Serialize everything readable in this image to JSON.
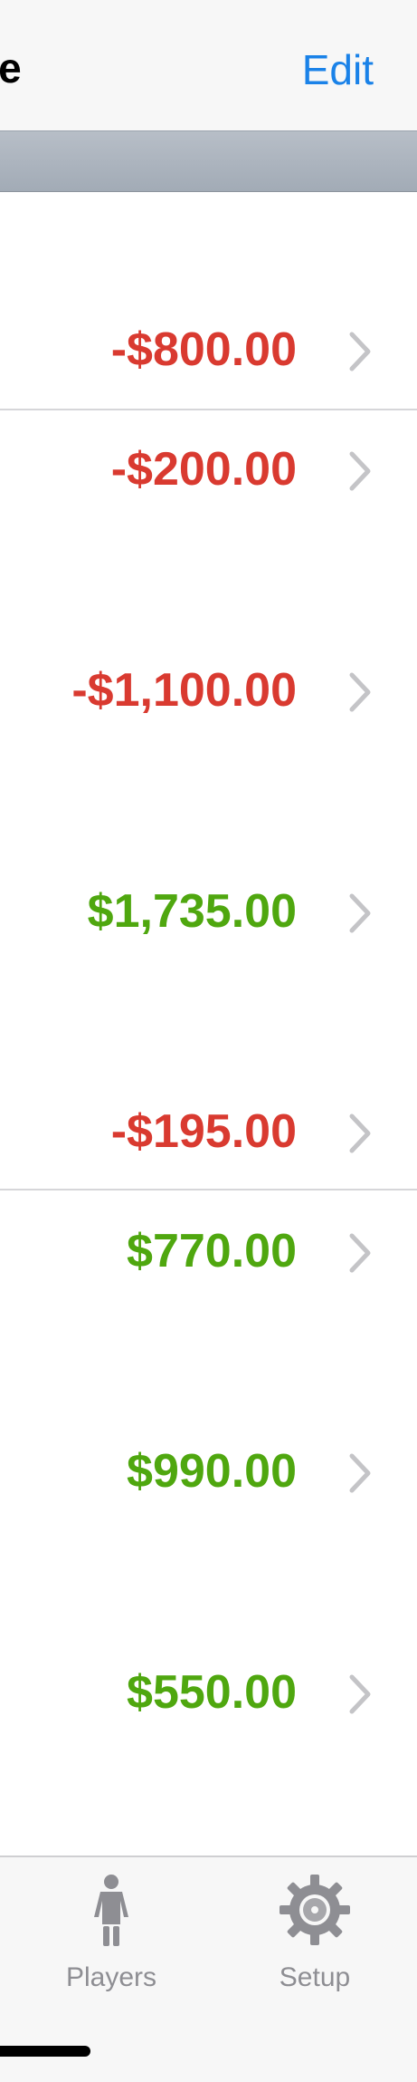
{
  "nav": {
    "title": "ne",
    "edit_label": "Edit"
  },
  "rows": [
    {
      "amount": "-$800.00",
      "status": "negative"
    },
    {
      "amount": "-$200.00",
      "status": "negative"
    },
    {
      "amount": "-$1,100.00",
      "status": "negative"
    },
    {
      "amount": "$1,735.00",
      "status": "positive"
    },
    {
      "amount": "-$195.00",
      "status": "negative"
    },
    {
      "amount": "$770.00",
      "status": "positive"
    },
    {
      "amount": "$990.00",
      "status": "positive"
    },
    {
      "amount": "$550.00",
      "status": "positive"
    }
  ],
  "tabs": [
    {
      "label": "Players",
      "icon": "person-icon"
    },
    {
      "label": "Setup",
      "icon": "gear-icon"
    }
  ],
  "colors": {
    "negative": "#d93a30",
    "positive": "#4fa70f",
    "accent": "#1a82e8",
    "chevron": "#c4c4c7",
    "tab_inactive": "#8e8e93"
  }
}
